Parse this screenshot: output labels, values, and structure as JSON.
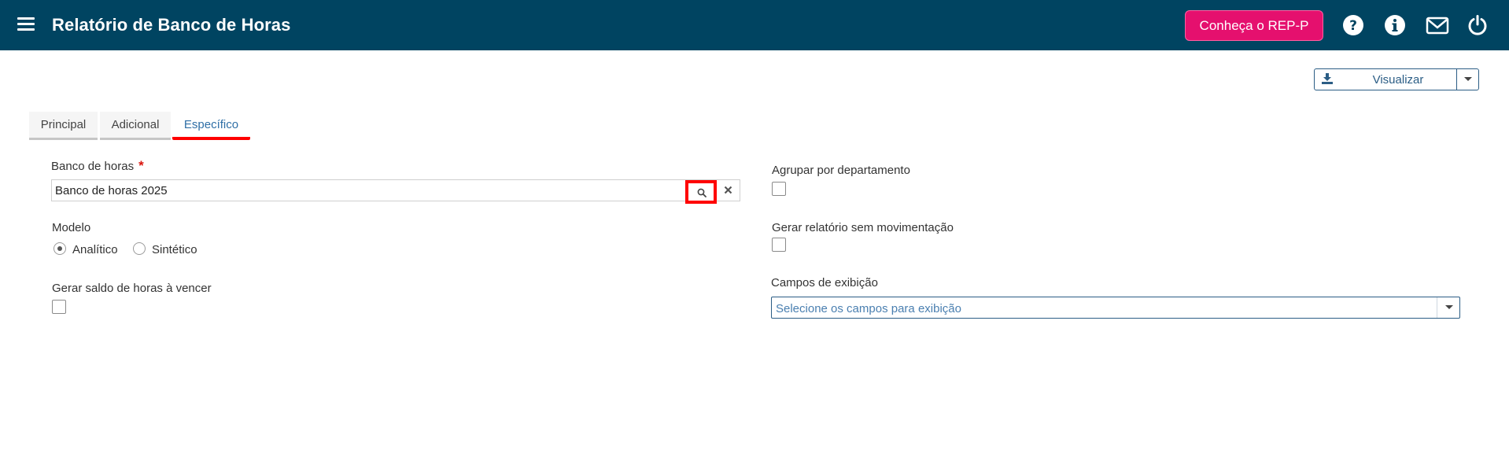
{
  "header": {
    "title": "Relatório de Banco de Horas",
    "rep_button_label": "Conheça o REP-P",
    "icons": [
      "menu-icon",
      "help-icon",
      "info-icon",
      "mail-icon",
      "power-icon"
    ],
    "background_color": "#004461",
    "accent_color": "#e5106e"
  },
  "toolbar": {
    "visualizar_label": "Visualizar",
    "visualizar_icon": "download-icon"
  },
  "tabs": [
    {
      "label": "Principal",
      "active": false
    },
    {
      "label": "Adicional",
      "active": false
    },
    {
      "label": "Específico",
      "active": true
    }
  ],
  "form": {
    "banco_de_horas": {
      "label": "Banco de horas",
      "required_mark": "*",
      "value": "Banco de horas 2025",
      "search_icon": "search-icon",
      "clear_icon": "close-icon"
    },
    "modelo": {
      "label": "Modelo",
      "options": [
        {
          "label": "Analítico",
          "checked": true
        },
        {
          "label": "Sintético",
          "checked": false
        }
      ]
    },
    "gerar_saldo": {
      "label": "Gerar saldo de horas à vencer",
      "checked": false
    },
    "agrupar_departamento": {
      "label": "Agrupar por departamento",
      "checked": false
    },
    "gerar_sem_movimentacao": {
      "label": "Gerar relatório sem movimentação",
      "checked": false
    },
    "campos_exibicao": {
      "label": "Campos de exibição",
      "placeholder": "Selecione os campos para exibição"
    }
  }
}
